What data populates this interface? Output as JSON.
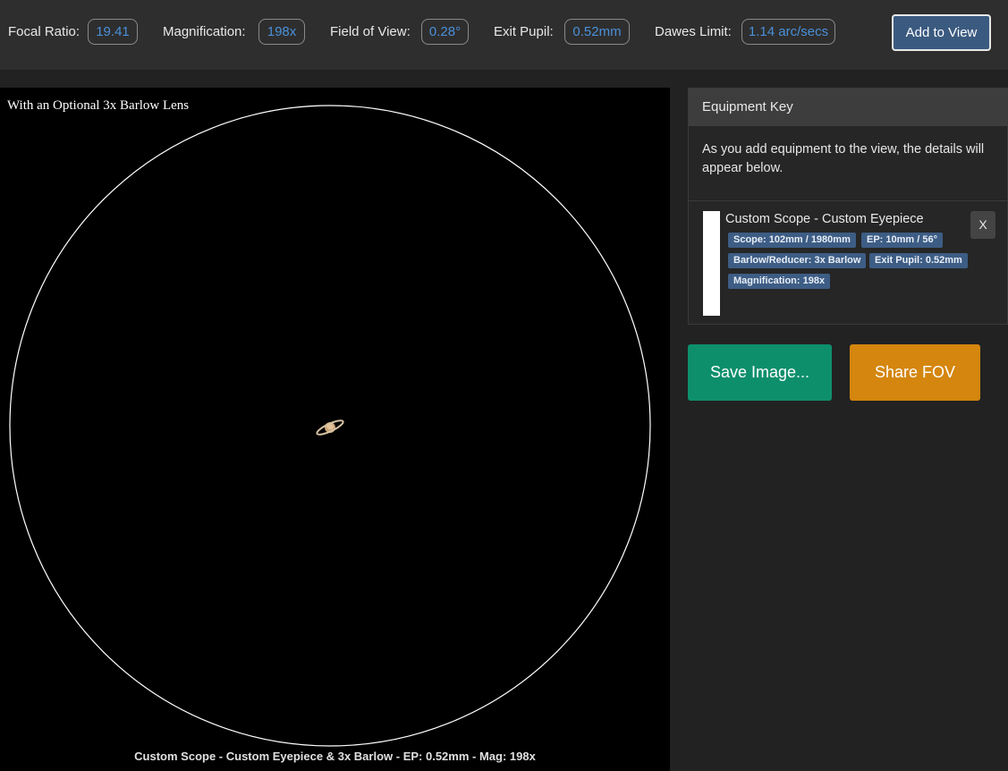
{
  "stats": {
    "focal_ratio": {
      "label": "Focal Ratio:",
      "value": "19.41"
    },
    "magnification": {
      "label": "Magnification:",
      "value": "198x"
    },
    "field_of_view": {
      "label": "Field of View:",
      "value": "0.28°"
    },
    "exit_pupil": {
      "label": "Exit Pupil:",
      "value": "0.52mm"
    },
    "dawes_limit": {
      "label": "Dawes Limit:",
      "value": "1.14 arc/secs"
    },
    "add_button": "Add to View",
    "value_color": "#4a90d9"
  },
  "viewer": {
    "title": "With an Optional 3x Barlow Lens",
    "caption": "Custom Scope - Custom Eyepiece & 3x Barlow - EP: 0.52mm - Mag: 198x",
    "object_icon": "saturn-icon"
  },
  "equipment_key": {
    "header": "Equipment Key",
    "description": "As you add equipment to the view, the details will appear below.",
    "item": {
      "title": "Custom Scope - Custom Eyepiece",
      "close_label": "X",
      "swatch_color": "#ffffff",
      "badges": {
        "scope": "Scope: 102mm / 1980mm",
        "eyepiece": "EP: 10mm / 56°",
        "barlow": "Barlow/Reducer: 3x Barlow",
        "exit_pupil": "Exit Pupil: 0.52mm",
        "magnification": "Magnification: 198x"
      }
    }
  },
  "actions": {
    "save_image": "Save Image...",
    "share_fov": "Share FOV",
    "save_color": "#0e8f6c",
    "share_color": "#d4860e"
  }
}
